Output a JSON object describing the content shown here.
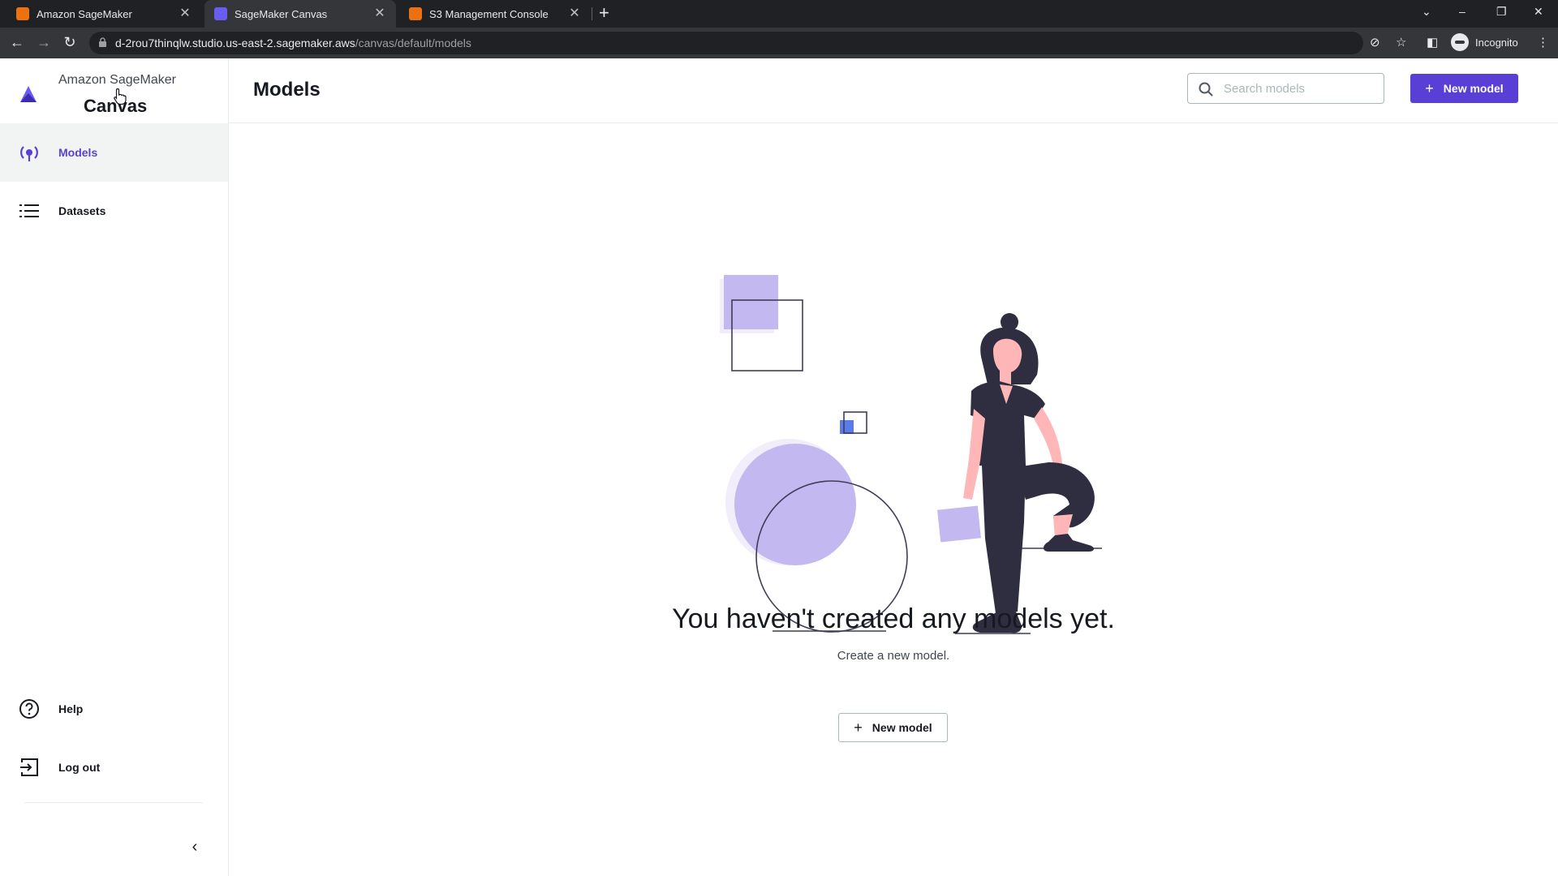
{
  "browser": {
    "tabs": [
      {
        "title": "Amazon SageMaker",
        "favicon_color": "#ec7211",
        "active": false
      },
      {
        "title": "SageMaker Canvas",
        "favicon_color": "#6b5cf0",
        "active": true
      },
      {
        "title": "S3 Management Console",
        "favicon_color": "#ec7211",
        "active": false
      }
    ],
    "new_tab_icon": "plus-icon",
    "url_host": "d-2rou7thinqlw.studio.us-east-2.sagemaker.aws",
    "url_path": "/canvas/default/models",
    "profile_label": "Incognito"
  },
  "sidebar": {
    "brand_sub": "Amazon SageMaker",
    "brand_name": "Canvas",
    "items": [
      {
        "label": "Models",
        "icon": "models-icon",
        "active": true
      },
      {
        "label": "Datasets",
        "icon": "list-icon",
        "active": false
      }
    ],
    "bottom_items": [
      {
        "label": "Help",
        "icon": "help-icon"
      },
      {
        "label": "Log out",
        "icon": "logout-icon"
      }
    ],
    "collapse_icon": "chevron-left-icon"
  },
  "header": {
    "title": "Models",
    "search_placeholder": "Search models",
    "new_model_label": "New model"
  },
  "empty_state": {
    "title": "You haven't created any models yet.",
    "subtitle": "Create a new model.",
    "button_label": "New model"
  },
  "colors": {
    "accent": "#5a3fd6",
    "illustration_lavender": "#c3b8ef",
    "illustration_figure": "#2f2e41",
    "illustration_skin": "#ffb6b6"
  }
}
